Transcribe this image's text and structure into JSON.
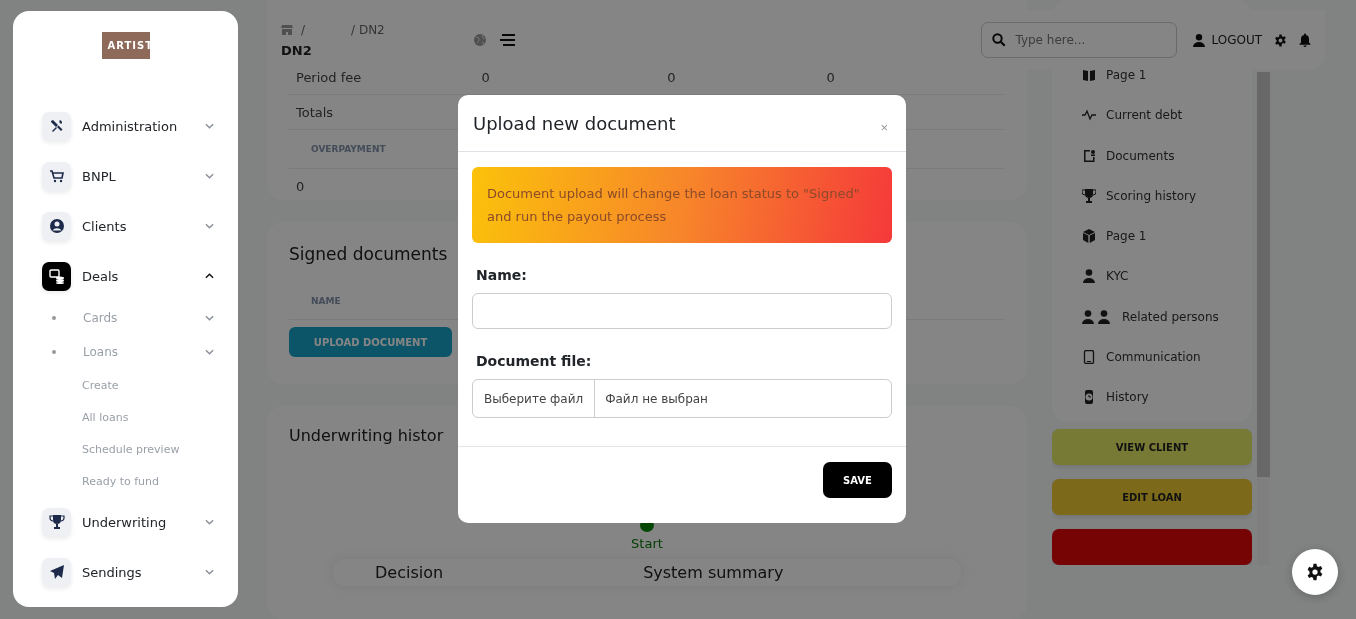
{
  "sidebar": {
    "logo": "ARTIST",
    "items": [
      {
        "label": "Administration",
        "selected": false,
        "expanded": false
      },
      {
        "label": "BNPL",
        "selected": false,
        "expanded": false
      },
      {
        "label": "Clients",
        "selected": false,
        "expanded": false
      },
      {
        "label": "Deals",
        "selected": true,
        "expanded": true,
        "children": [
          {
            "kind": "bullet",
            "label": "Cards",
            "expanded": false
          },
          {
            "kind": "bullet",
            "label": "Loans",
            "expanded": false
          },
          {
            "kind": "link",
            "label": "Create"
          },
          {
            "kind": "link",
            "label": "All loans"
          },
          {
            "kind": "link",
            "label": "Schedule preview"
          },
          {
            "kind": "link",
            "label": "Ready to fund"
          }
        ]
      },
      {
        "label": "Underwriting",
        "selected": false,
        "expanded": false
      },
      {
        "label": "Sendings",
        "selected": false,
        "expanded": false
      }
    ]
  },
  "navbar": {
    "breadcrumb": [
      "/",
      "/ DN2"
    ],
    "title": "DN2",
    "search": {
      "placeholder": "Type here..."
    },
    "logout": "LOGOUT"
  },
  "loan_table": {
    "rows": [
      {
        "label": "Period fee",
        "values": [
          "0",
          "0",
          "0"
        ]
      },
      {
        "label": "Totals",
        "values": []
      }
    ],
    "subheader": "OVERPAYMENT",
    "subrow": "0"
  },
  "signed_documents": {
    "title": "Signed documents",
    "column": "NAME",
    "upload_button": "UPLOAD DOCUMENT"
  },
  "underwriting": {
    "title": "Underwriting histor",
    "start": "Start",
    "decision": "Decision",
    "system_summary": "System summary"
  },
  "right_menu": {
    "items": [
      "Page 1",
      "Current debt",
      "Documents",
      "Scoring history",
      "Page 1",
      "KYC",
      "Related persons",
      "Communication",
      "History"
    ],
    "buttons": [
      {
        "label": "VIEW CLIENT",
        "color": "#777a35"
      },
      {
        "label": "EDIT LOAN",
        "color": "#7c6a1a"
      },
      {
        "color": "#760404"
      }
    ]
  },
  "modal": {
    "title": "Upload new document",
    "close": "×",
    "alert": "Document upload will change the loan status to \"Signed\" and run the payout process",
    "name_label": "Name:",
    "file_label": "Document file:",
    "file_button": "Выберите файл",
    "file_status": "Файл не выбран",
    "save": "SAVE"
  }
}
